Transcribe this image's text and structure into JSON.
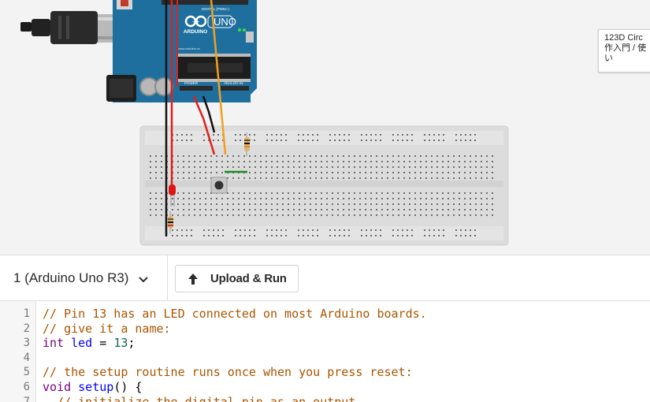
{
  "canvas": {
    "board": {
      "brand": "ARDUINO",
      "model": "UNO",
      "header_digital": "DIGITAL (PWM~)",
      "header_power": "POWER",
      "header_analog": "ANALOG IN",
      "site": "www.arduino.cc"
    },
    "tooltip": "123D Circ\n作入門 / 使\nい",
    "colors": {
      "board": "#1f6f9e",
      "wire_red": "#e0201b",
      "wire_orange": "#f0a020",
      "wire_black": "#111111",
      "wire_green": "#1f8a2a",
      "led": "#e01515",
      "breadboard": "#dcdcdc"
    }
  },
  "toolbar": {
    "device_label": "1 (Arduino Uno R3)",
    "device_icon": "chevron-down-icon",
    "upload_label": "Upload & Run",
    "upload_icon": "arrow-up-icon"
  },
  "editor": {
    "lines": [
      {
        "n": "1",
        "segments": [
          {
            "t": "// Pin 13 has an LED connected on most Arduino boards.",
            "c": "c-comment"
          }
        ]
      },
      {
        "n": "2",
        "segments": [
          {
            "t": "// give it a name:",
            "c": "c-comment"
          }
        ]
      },
      {
        "n": "3",
        "segments": [
          {
            "t": "int",
            "c": "c-type"
          },
          {
            "t": " ",
            "c": "c-plain"
          },
          {
            "t": "led",
            "c": "c-def"
          },
          {
            "t": " = ",
            "c": "c-plain"
          },
          {
            "t": "13",
            "c": "c-num"
          },
          {
            "t": ";",
            "c": "c-plain"
          }
        ]
      },
      {
        "n": "4",
        "segments": []
      },
      {
        "n": "5",
        "segments": [
          {
            "t": "// the setup routine runs once when you press reset:",
            "c": "c-comment"
          }
        ]
      },
      {
        "n": "6",
        "segments": [
          {
            "t": "void",
            "c": "c-type"
          },
          {
            "t": " ",
            "c": "c-plain"
          },
          {
            "t": "setup",
            "c": "c-def"
          },
          {
            "t": "() {",
            "c": "c-plain"
          }
        ]
      },
      {
        "n": "7",
        "segments": [
          {
            "t": "  // initialize the digital pin as an output.",
            "c": "c-comment"
          }
        ]
      }
    ]
  }
}
